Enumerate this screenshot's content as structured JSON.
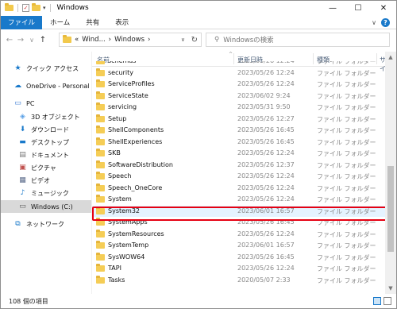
{
  "window": {
    "title": "Windows",
    "controls": {
      "minimize": "—",
      "maximize": "☐",
      "close": "✕"
    }
  },
  "ribbon": {
    "tabs": [
      "ファイル",
      "ホーム",
      "共有",
      "表示"
    ],
    "expand_icon": "chevron-down-icon",
    "help_icon": "?"
  },
  "address": {
    "back": "←",
    "forward": "→",
    "recent": "∨",
    "up": "↑",
    "path": [
      "«",
      "Wind...",
      "›",
      "Windows",
      "›"
    ],
    "search_placeholder": "Windowsの検索"
  },
  "sidebar": {
    "items": [
      {
        "label": "クイック アクセス",
        "icon": "star-icon"
      },
      {
        "label": "OneDrive - Personal",
        "icon": "cloud-icon"
      },
      {
        "label": "PC",
        "icon": "pc-icon"
      },
      {
        "label": "3D オブジェクト",
        "icon": "cube-icon"
      },
      {
        "label": "ダウンロード",
        "icon": "download-icon"
      },
      {
        "label": "デスクトップ",
        "icon": "desktop-icon"
      },
      {
        "label": "ドキュメント",
        "icon": "document-icon"
      },
      {
        "label": "ピクチャ",
        "icon": "picture-icon"
      },
      {
        "label": "ビデオ",
        "icon": "video-icon"
      },
      {
        "label": "ミュージック",
        "icon": "music-icon"
      },
      {
        "label": "Windows (C:)",
        "icon": "drive-icon"
      },
      {
        "label": "ネットワーク",
        "icon": "network-icon"
      }
    ]
  },
  "columns": {
    "name": "名前",
    "date": "更新日時",
    "type": "種類",
    "size": "サイ"
  },
  "files": [
    {
      "name": "schemas",
      "date": "2023/05/26 12:24",
      "type": "ファイル フォルダー"
    },
    {
      "name": "security",
      "date": "2023/05/26 12:24",
      "type": "ファイル フォルダー"
    },
    {
      "name": "ServiceProfiles",
      "date": "2023/05/26 12:24",
      "type": "ファイル フォルダー"
    },
    {
      "name": "ServiceState",
      "date": "2023/06/02 9:24",
      "type": "ファイル フォルダー"
    },
    {
      "name": "servicing",
      "date": "2023/05/31 9:50",
      "type": "ファイル フォルダー"
    },
    {
      "name": "Setup",
      "date": "2023/05/26 12:27",
      "type": "ファイル フォルダー"
    },
    {
      "name": "ShellComponents",
      "date": "2023/05/26 16:45",
      "type": "ファイル フォルダー"
    },
    {
      "name": "ShellExperiences",
      "date": "2023/05/26 16:45",
      "type": "ファイル フォルダー"
    },
    {
      "name": "SKB",
      "date": "2023/05/26 12:24",
      "type": "ファイル フォルダー"
    },
    {
      "name": "SoftwareDistribution",
      "date": "2023/05/26 12:37",
      "type": "ファイル フォルダー"
    },
    {
      "name": "Speech",
      "date": "2023/05/26 12:24",
      "type": "ファイル フォルダー"
    },
    {
      "name": "Speech_OneCore",
      "date": "2023/05/26 12:24",
      "type": "ファイル フォルダー"
    },
    {
      "name": "System",
      "date": "2023/05/26 12:24",
      "type": "ファイル フォルダー"
    },
    {
      "name": "System32",
      "date": "2023/06/01 16:57",
      "type": "ファイル フォルダー"
    },
    {
      "name": "SystemApps",
      "date": "2023/05/26 16:45",
      "type": "ファイル フォルダー"
    },
    {
      "name": "SystemResources",
      "date": "2023/05/26 12:24",
      "type": "ファイル フォルダー"
    },
    {
      "name": "SystemTemp",
      "date": "2023/06/01 16:57",
      "type": "ファイル フォルダー"
    },
    {
      "name": "SysWOW64",
      "date": "2023/05/26 16:45",
      "type": "ファイル フォルダー"
    },
    {
      "name": "TAPI",
      "date": "2023/05/26 12:24",
      "type": "ファイル フォルダー"
    },
    {
      "name": "Tasks",
      "date": "2020/05/07 2:33",
      "type": "ファイル フォルダー"
    }
  ],
  "highlighted_file": "System32",
  "status": {
    "item_count": "108 個の項目"
  },
  "colors": {
    "accent": "#1979ca",
    "highlight_border": "#e60012",
    "folder": "#f5cd56"
  }
}
